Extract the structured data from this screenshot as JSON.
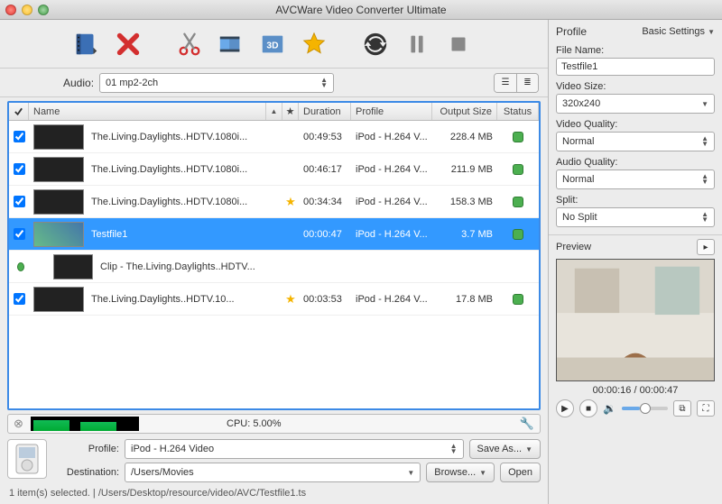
{
  "window": {
    "title": "AVCWare Video Converter Ultimate"
  },
  "toolbar": {
    "audio_label": "Audio:",
    "audio_value": "01 mp2-2ch"
  },
  "table": {
    "headers": {
      "name": "Name",
      "duration": "Duration",
      "profile": "Profile",
      "output_size": "Output Size",
      "status": "Status"
    },
    "rows": [
      {
        "checked": true,
        "name": "The.Living.Daylights..HDTV.1080i...",
        "fav": false,
        "duration": "00:49:53",
        "profile": "iPod - H.264 V...",
        "size": "228.4 MB",
        "status": true,
        "child": false,
        "selected": false
      },
      {
        "checked": true,
        "name": "The.Living.Daylights..HDTV.1080i...",
        "fav": false,
        "duration": "00:46:17",
        "profile": "iPod - H.264 V...",
        "size": "211.9 MB",
        "status": true,
        "child": false,
        "selected": false
      },
      {
        "checked": true,
        "name": "The.Living.Daylights..HDTV.1080i...",
        "fav": true,
        "duration": "00:34:34",
        "profile": "iPod - H.264 V...",
        "size": "158.3 MB",
        "status": true,
        "child": false,
        "selected": false
      },
      {
        "checked": true,
        "name": "Testfile1",
        "fav": false,
        "duration": "00:00:47",
        "profile": "iPod - H.264 V...",
        "size": "3.7 MB",
        "status": true,
        "child": false,
        "selected": true
      },
      {
        "checked": false,
        "name": "Clip - The.Living.Daylights..HDTV...",
        "fav": false,
        "duration": "",
        "profile": "",
        "size": "",
        "status": false,
        "child": true,
        "selected": false
      },
      {
        "checked": true,
        "name": "The.Living.Daylights..HDTV.10...",
        "fav": true,
        "duration": "00:03:53",
        "profile": "iPod - H.264 V...",
        "size": "17.8 MB",
        "status": true,
        "child": false,
        "selected": false
      }
    ]
  },
  "cpu": {
    "label": "CPU: 5.00%"
  },
  "bottom": {
    "profile_label": "Profile:",
    "profile_value": "iPod - H.264 Video",
    "saveas_label": "Save As...",
    "dest_label": "Destination:",
    "dest_value": "/Users/Movies",
    "browse_label": "Browse...",
    "open_label": "Open"
  },
  "statusline": "1 item(s) selected. | /Users/Desktop/resource/video/AVC/Testfile1.ts",
  "profile_panel": {
    "heading": "Profile",
    "basic_settings": "Basic Settings",
    "filename_label": "File Name:",
    "filename_value": "Testfile1",
    "videosize_label": "Video Size:",
    "videosize_value": "320x240",
    "videoquality_label": "Video Quality:",
    "videoquality_value": "Normal",
    "audioquality_label": "Audio Quality:",
    "audioquality_value": "Normal",
    "split_label": "Split:",
    "split_value": "No Split"
  },
  "preview": {
    "heading": "Preview",
    "time": "00:00:16 / 00:00:47"
  }
}
